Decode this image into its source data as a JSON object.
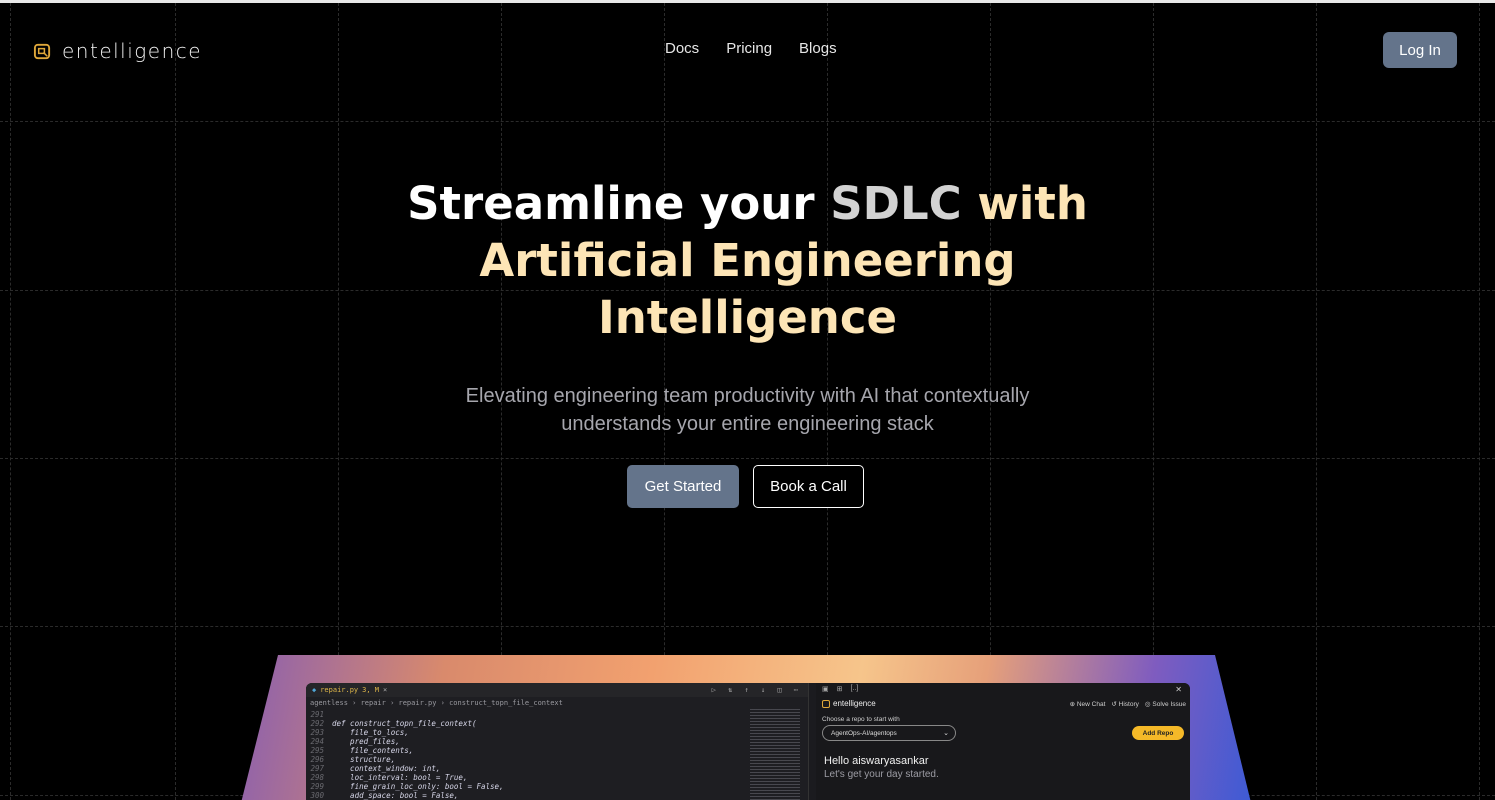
{
  "brand": {
    "name": "entelligence",
    "accent": "#e0a83a"
  },
  "nav": {
    "links": [
      "Docs",
      "Pricing",
      "Blogs"
    ],
    "login_label": "Log In"
  },
  "hero": {
    "headline_part1": "Streamline your ",
    "headline_part2": "SDLC",
    "headline_part3": " with",
    "headline_line2": "Artificial Engineering",
    "headline_line3": "Intelligence",
    "subtitle_line1": "Elevating engineering team productivity with AI that contextually",
    "subtitle_line2": "understands your entire engineering stack",
    "primary_cta": "Get Started",
    "secondary_cta": "Book a Call"
  },
  "mockup": {
    "tab": {
      "filename": "repair.py",
      "status": "3, M",
      "close": "×"
    },
    "breadcrumb": "agentless › repair › repair.py › construct_topn_file_context",
    "code_lines": [
      {
        "n": "291",
        "t": ""
      },
      {
        "n": "292",
        "t": "def construct_topn_file_context("
      },
      {
        "n": "293",
        "t": "    file_to_locs,"
      },
      {
        "n": "294",
        "t": "    pred_files,"
      },
      {
        "n": "295",
        "t": "    file_contents,"
      },
      {
        "n": "296",
        "t": "    structure,"
      },
      {
        "n": "297",
        "t": "    context_window: int,"
      },
      {
        "n": "298",
        "t": "    loc_interval: bool = True,"
      },
      {
        "n": "299",
        "t": "    fine_grain_loc_only: bool = False,"
      },
      {
        "n": "300",
        "t": "    add_space: bool = False,"
      }
    ],
    "panel": {
      "brand": "entelligence",
      "actions": [
        "New Chat",
        "History",
        "Solve Issue"
      ],
      "choose_label": "Choose a repo to start with",
      "repo_value": "AgentOps-AI/agentops",
      "add_repo": "Add Repo",
      "greeting": "Hello aiswaryasankar",
      "subgreeting": "Let's get your day started."
    }
  },
  "colors": {
    "button": "#64748b",
    "gold": "#fde5b6"
  }
}
